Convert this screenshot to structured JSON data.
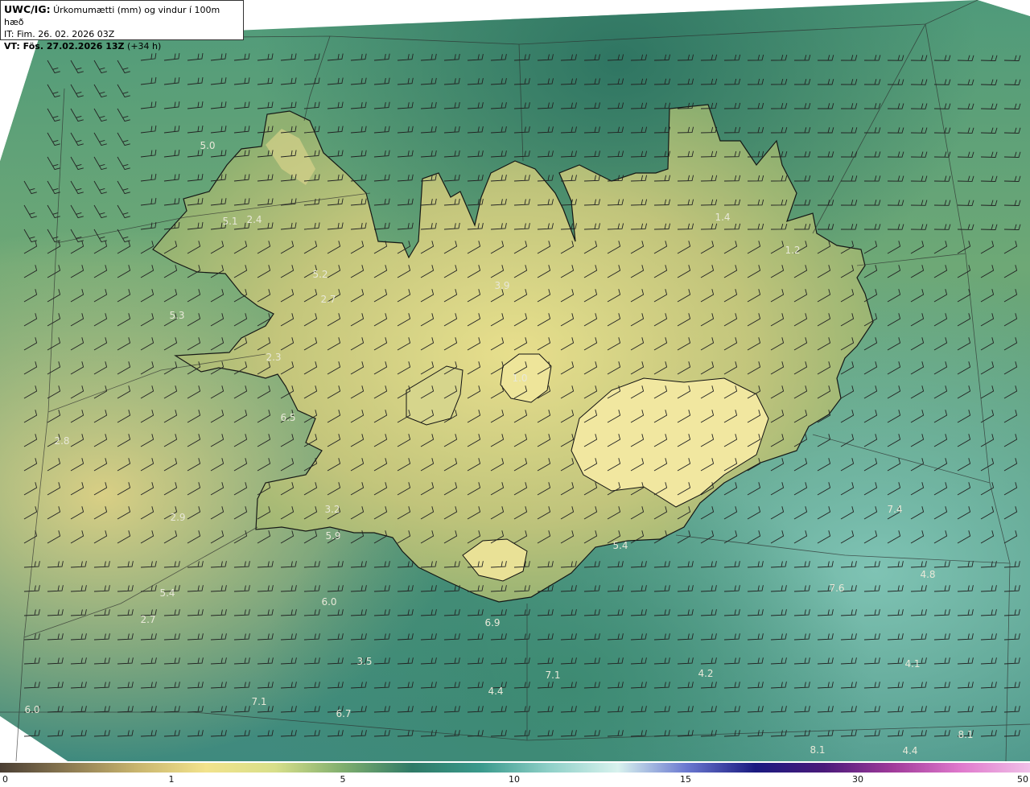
{
  "header": {
    "line1_bold": "UWC/IG:",
    "line1_text": "Úrkomumætti (mm) og vindur í 100m hæð",
    "line2": "IT: Fim. 26. 02. 2026 03Z",
    "line3_bold": "VT: Fös. 27.02.2026 13Z",
    "line3_text": "(+34 h)"
  },
  "colorbar": {
    "ticks": [
      "0",
      "1",
      "5",
      "10",
      "15",
      "30",
      "50"
    ],
    "colors": [
      "#4a3e33",
      "#8c7a52",
      "#c9b56e",
      "#f2e38c",
      "#d8df8a",
      "#7fae6e",
      "#2f7a67",
      "#3a9a8c",
      "#8fd0c8",
      "#d8f2ee",
      "#6a78d0",
      "#1a1a80",
      "#4a1a7a",
      "#a03a9a",
      "#e07acd",
      "#f0c0e8"
    ]
  },
  "value_labels": [
    {
      "text": "5.0"
    },
    {
      "text": "5.1"
    },
    {
      "text": "2.4"
    },
    {
      "text": "5.2"
    },
    {
      "text": "2.7"
    },
    {
      "text": "5.3"
    },
    {
      "text": "2.3"
    },
    {
      "text": "6.5"
    },
    {
      "text": "2.8"
    },
    {
      "text": "3.9"
    },
    {
      "text": "1.0"
    },
    {
      "text": "1.4"
    },
    {
      "text": "1.2"
    },
    {
      "text": "3.2"
    },
    {
      "text": "5.9"
    },
    {
      "text": "2.9"
    },
    {
      "text": "5.4"
    },
    {
      "text": "5.4"
    },
    {
      "text": "6.0"
    },
    {
      "text": "2.7"
    },
    {
      "text": "6.9"
    },
    {
      "text": "3.5"
    },
    {
      "text": "7.1"
    },
    {
      "text": "4.4"
    },
    {
      "text": "4.2"
    },
    {
      "text": "7.4"
    },
    {
      "text": "4.8"
    },
    {
      "text": "7.6"
    },
    {
      "text": "4.1"
    },
    {
      "text": "6.0"
    },
    {
      "text": "7.1"
    },
    {
      "text": "6.7"
    },
    {
      "text": "8.1"
    },
    {
      "text": "8.1"
    },
    {
      "text": "4.4"
    }
  ]
}
